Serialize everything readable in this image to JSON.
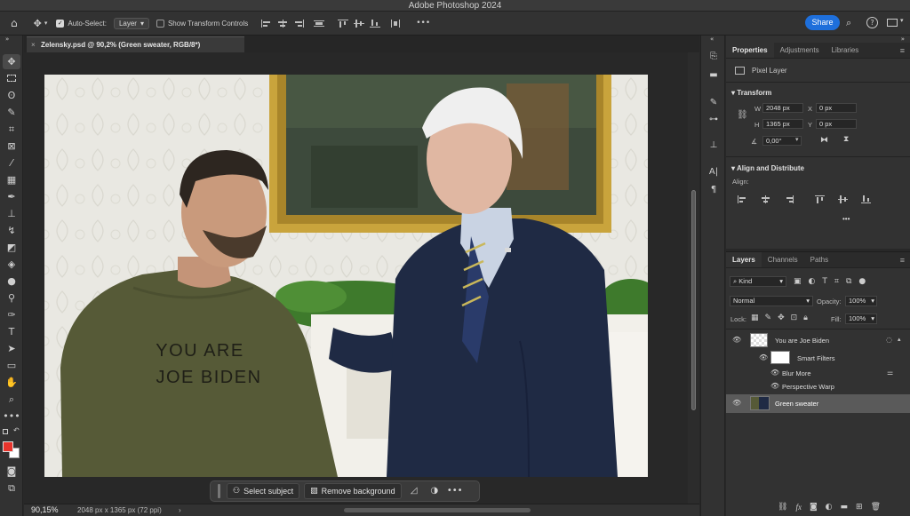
{
  "app": {
    "title": "Adobe Photoshop 2024"
  },
  "options_bar": {
    "auto_select_label": "Auto-Select:",
    "auto_select_target": "Layer",
    "show_transform_label": "Show Transform Controls",
    "share_label": "Share",
    "more_label": "•••"
  },
  "document": {
    "tab_title": "Zelensky.psd @ 90,2% (Green sweater, RGB/8*)",
    "sweater_text_line1": "YOU ARE",
    "sweater_text_line2": "JOE BIDEN"
  },
  "status": {
    "zoom": "90,15%",
    "dimensions": "2048 px x 1365 px (72 ppi)",
    "arrow": "›"
  },
  "context_bar": {
    "select_subject": "Select subject",
    "remove_background": "Remove background",
    "more": "•••"
  },
  "properties": {
    "tabs": [
      "Properties",
      "Adjustments",
      "Libraries"
    ],
    "layer_kind": "Pixel Layer",
    "transform_title": "Transform",
    "w_label": "W",
    "w_value": "2048 px",
    "h_label": "H",
    "h_value": "1365 px",
    "x_label": "X",
    "x_value": "0 px",
    "y_label": "Y",
    "y_value": "0 px",
    "angle_value": "0,00°",
    "align_title": "Align and Distribute",
    "align_label": "Align:",
    "more": "•••"
  },
  "layers": {
    "tabs": [
      "Layers",
      "Channels",
      "Paths"
    ],
    "kind_filter": "Kind",
    "blend_mode": "Normal",
    "opacity_label": "Opacity:",
    "opacity_value": "100%",
    "lock_label": "Lock:",
    "fill_label": "Fill:",
    "fill_value": "100%",
    "items": [
      {
        "name": "You are  Joe Biden"
      },
      {
        "name": "Smart Filters"
      },
      {
        "name": "Blur More"
      },
      {
        "name": "Perspective Warp"
      },
      {
        "name": "Green sweater"
      }
    ]
  },
  "colors": {
    "accent": "#1e6fdb",
    "foreground": "#e8342c",
    "background": "#ffffff",
    "selected_layer": "#5a5a5a"
  }
}
